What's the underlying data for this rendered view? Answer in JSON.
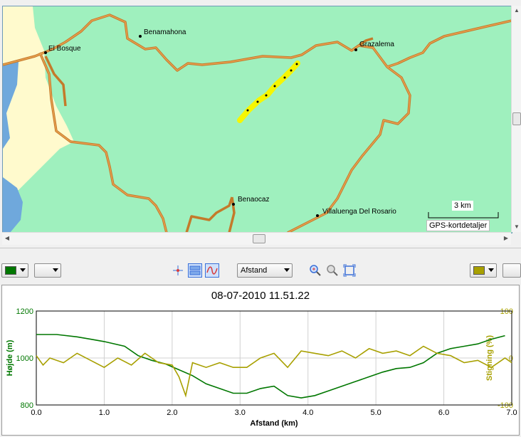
{
  "map": {
    "places": [
      {
        "name": "Benamahona"
      },
      {
        "name": "El Bosque"
      },
      {
        "name": "Grazalema"
      },
      {
        "name": "Benaocaz"
      },
      {
        "name": "Villaluenga Del Rosario"
      }
    ],
    "scale_label": "3 km",
    "details_button": "GPS-kortdetaljer",
    "colors": {
      "land": "#9ff0be",
      "road": "#d8913a",
      "track": "#f6f600",
      "water": "#6fa8dc",
      "sand": "#fffacd"
    }
  },
  "toolbar": {
    "left_color": "#007700",
    "right_color": "#a8a000",
    "axis_select": "Afstand",
    "icons": [
      "crosshair-icon",
      "stacked-view-icon",
      "curve-view-icon",
      "zoom-in-icon",
      "zoom-out-icon",
      "fit-view-icon"
    ]
  },
  "chart_data": {
    "type": "line",
    "title": "08-07-2010 11.51.22",
    "xlabel": "Afstand (km)",
    "ylabel_left": "Højde (m)",
    "ylabel_right": "Stigning (%)",
    "xlim": [
      0,
      7
    ],
    "ylim_left": [
      800,
      1200
    ],
    "ylim_right": [
      -100,
      100
    ],
    "x_ticks": [
      "0.0",
      "1.0",
      "2.0",
      "3.0",
      "4.0",
      "5.0",
      "6.0",
      "7.0"
    ],
    "y_left_ticks": [
      "1200",
      "1000",
      "800"
    ],
    "y_right_ticks": [
      "100",
      "0",
      "-100"
    ],
    "grid": true,
    "series": [
      {
        "color": "#007700",
        "axis": "left",
        "x": [
          0.0,
          0.3,
          0.6,
          0.8,
          1.0,
          1.3,
          1.5,
          1.7,
          1.9,
          2.1,
          2.3,
          2.5,
          2.7,
          2.9,
          3.1,
          3.3,
          3.5,
          3.7,
          3.9,
          4.1,
          4.3,
          4.5,
          4.7,
          4.9,
          5.1,
          5.3,
          5.5,
          5.7,
          5.9,
          6.1,
          6.3,
          6.5,
          6.7,
          6.9
        ],
        "values": [
          1100,
          1100,
          1090,
          1080,
          1070,
          1050,
          1010,
          990,
          975,
          950,
          925,
          890,
          870,
          850,
          850,
          870,
          880,
          840,
          830,
          840,
          860,
          880,
          900,
          920,
          940,
          955,
          960,
          980,
          1020,
          1040,
          1050,
          1060,
          1080,
          1095
        ]
      },
      {
        "color": "#a8a000",
        "axis": "right",
        "x": [
          0.0,
          0.1,
          0.2,
          0.4,
          0.6,
          0.8,
          1.0,
          1.2,
          1.4,
          1.6,
          1.8,
          2.0,
          2.1,
          2.2,
          2.3,
          2.5,
          2.7,
          2.9,
          3.1,
          3.3,
          3.5,
          3.7,
          3.9,
          4.1,
          4.3,
          4.5,
          4.7,
          4.9,
          5.1,
          5.3,
          5.5,
          5.7,
          5.9,
          6.1,
          6.3,
          6.5,
          6.7,
          6.9,
          7.0
        ],
        "values": [
          5,
          -15,
          0,
          -10,
          10,
          -5,
          -20,
          0,
          -15,
          10,
          -10,
          -15,
          -40,
          -80,
          -10,
          -20,
          -10,
          -20,
          -20,
          0,
          10,
          -20,
          15,
          10,
          5,
          15,
          0,
          20,
          10,
          15,
          5,
          25,
          10,
          5,
          -10,
          -5,
          -20,
          0,
          -10
        ]
      }
    ]
  }
}
